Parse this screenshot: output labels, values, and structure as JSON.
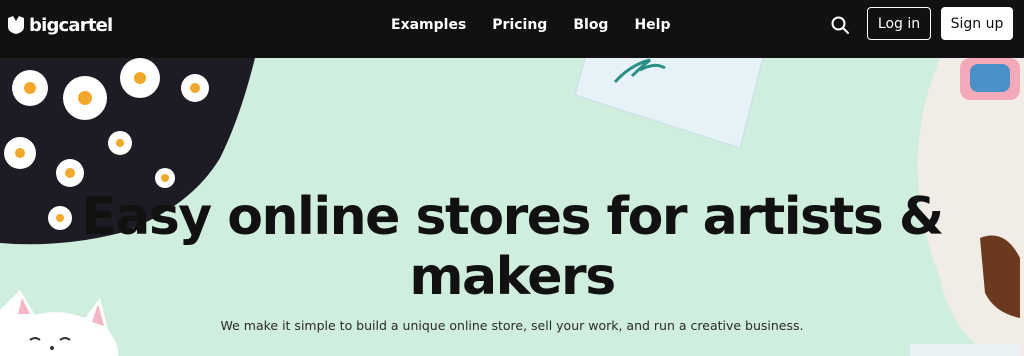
{
  "brand": {
    "name": "bigcartel"
  },
  "nav": {
    "links": [
      "Examples",
      "Pricing",
      "Blog",
      "Help"
    ]
  },
  "actions": {
    "login_label": "Log in",
    "signup_label": "Sign up"
  },
  "hero": {
    "title": "Easy online stores for artists & makers",
    "subtitle": "We make it simple to build a unique online store, sell your work, and run a creative business."
  },
  "colors": {
    "nav_bg": "#121010",
    "hero_bg": "#cfeedd",
    "text_dark": "#111111"
  },
  "icons": [
    "bigcartel-logo-icon",
    "search-icon"
  ]
}
